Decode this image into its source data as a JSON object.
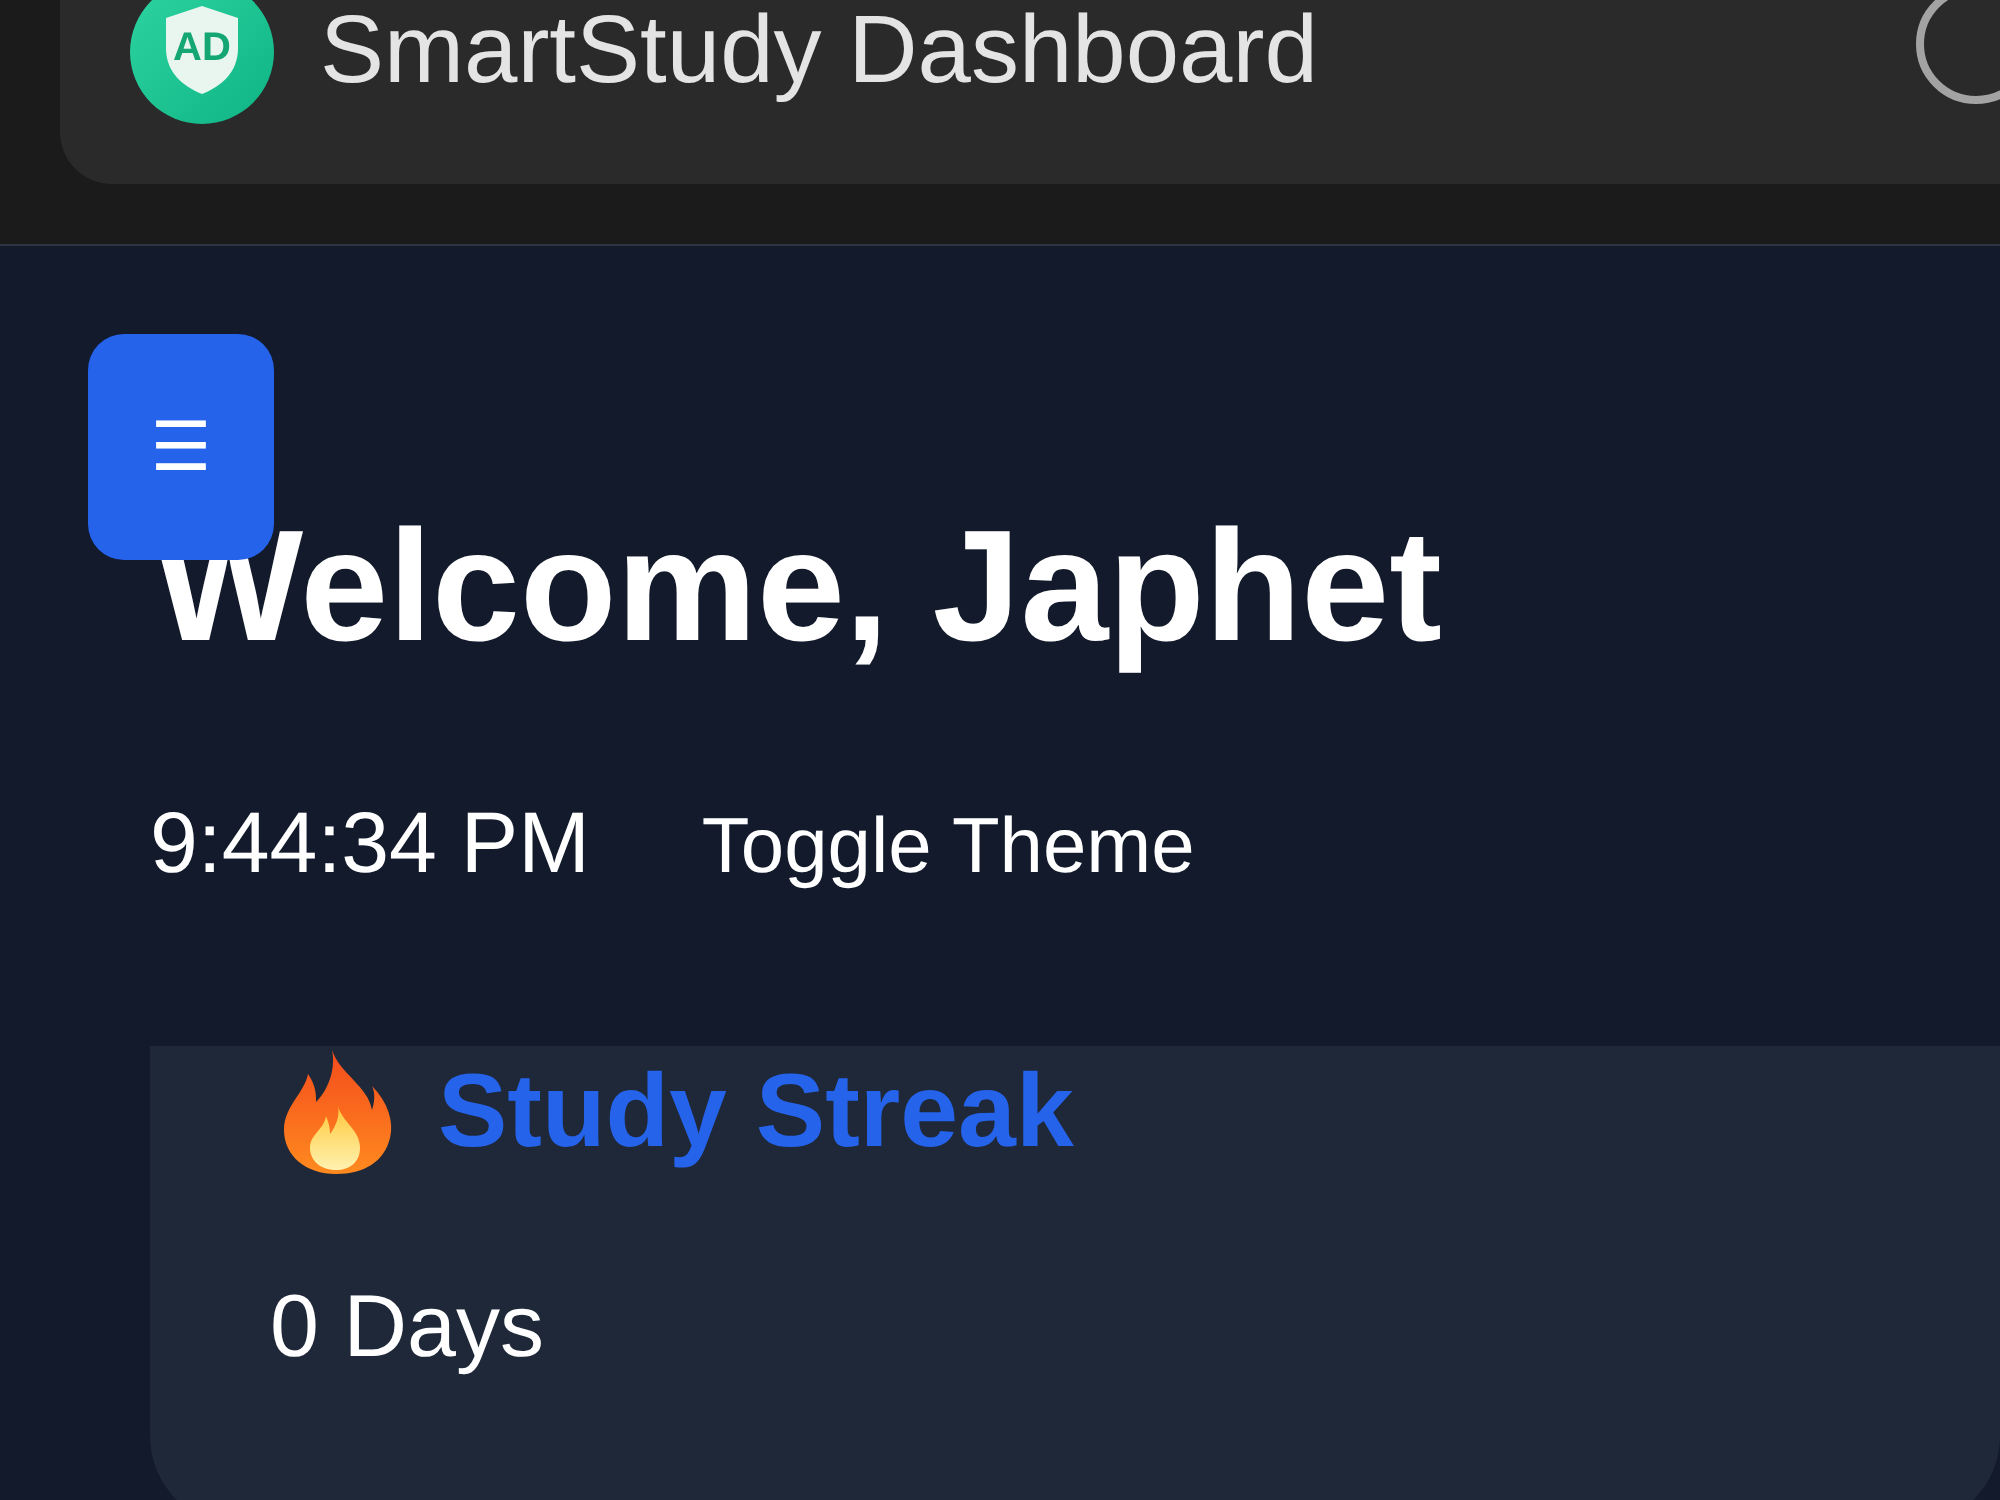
{
  "app_bar": {
    "logo_text": "AD",
    "title": "SmartStudy Dashboard"
  },
  "menu_button": {
    "label": "☰"
  },
  "welcome": {
    "heading": "Welcome, Japhet",
    "clock": "9:44:34 PM",
    "toggle_label": "Toggle Theme"
  },
  "streak_card": {
    "title": "Study Streak",
    "value": "0 Days"
  }
}
